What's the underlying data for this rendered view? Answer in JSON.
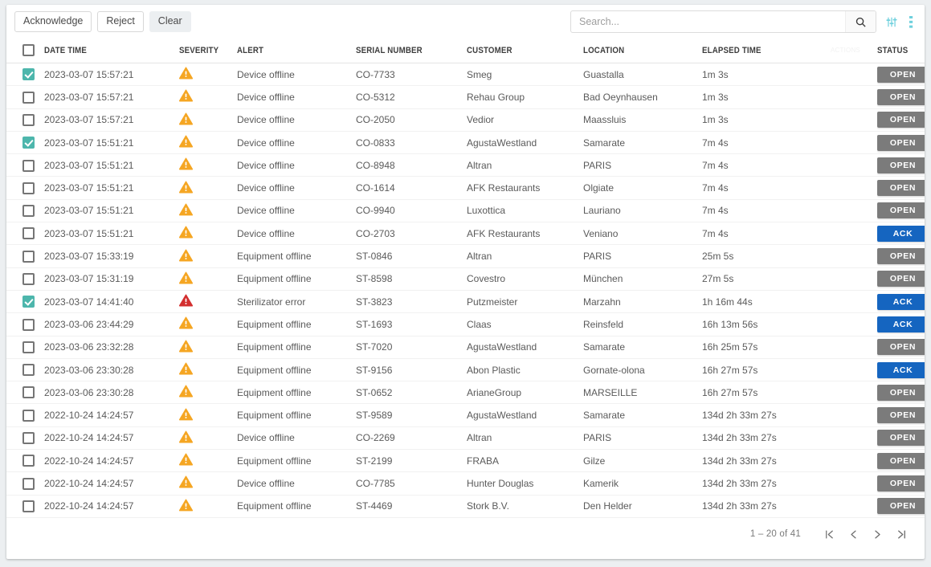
{
  "toolbar": {
    "acknowledge_label": "Acknowledge",
    "reject_label": "Reject",
    "clear_label": "Clear",
    "search_placeholder": "Search...",
    "search_value": "",
    "search_icon": "search-icon",
    "tune_icon": "sliders-filter-icon",
    "menu_icon": "more-vertical-icon",
    "accent_color": "#6fd0dd"
  },
  "table": {
    "headers": {
      "select_all": "",
      "date_time": "DATE TIME",
      "severity": "SEVERITY",
      "alert": "ALERT",
      "serial_number": "SERIAL NUMBER",
      "customer": "CUSTOMER",
      "location": "LOCATION",
      "elapsed_time": "ELAPSED TIME",
      "ghost": "ACTIONS",
      "status": "STATUS"
    },
    "colors": {
      "severity_warning": "#f5a623",
      "severity_critical": "#d32f2f",
      "status_open": "#7b7b7b",
      "status_ack": "#1565c0",
      "checkbox_checked": "#4db6ac"
    },
    "rows": [
      {
        "selected": true,
        "date_time": "2023-03-07 15:57:21",
        "severity": "warning",
        "alert": "Device offline",
        "serial_number": "CO-7733",
        "customer": "Smeg",
        "location": "Guastalla",
        "elapsed_time": "1m 3s",
        "status": "OPEN"
      },
      {
        "selected": false,
        "date_time": "2023-03-07 15:57:21",
        "severity": "warning",
        "alert": "Device offline",
        "serial_number": "CO-5312",
        "customer": "Rehau Group",
        "location": "Bad Oeynhausen",
        "elapsed_time": "1m 3s",
        "status": "OPEN"
      },
      {
        "selected": false,
        "date_time": "2023-03-07 15:57:21",
        "severity": "warning",
        "alert": "Device offline",
        "serial_number": "CO-2050",
        "customer": "Vedior",
        "location": "Maassluis",
        "elapsed_time": "1m 3s",
        "status": "OPEN"
      },
      {
        "selected": true,
        "date_time": "2023-03-07 15:51:21",
        "severity": "warning",
        "alert": "Device offline",
        "serial_number": "CO-0833",
        "customer": "AgustaWestland",
        "location": "Samarate",
        "elapsed_time": "7m 4s",
        "status": "OPEN"
      },
      {
        "selected": false,
        "date_time": "2023-03-07 15:51:21",
        "severity": "warning",
        "alert": "Device offline",
        "serial_number": "CO-8948",
        "customer": "Altran",
        "location": "PARIS",
        "elapsed_time": "7m 4s",
        "status": "OPEN"
      },
      {
        "selected": false,
        "date_time": "2023-03-07 15:51:21",
        "severity": "warning",
        "alert": "Device offline",
        "serial_number": "CO-1614",
        "customer": "AFK Restaurants",
        "location": "Olgiate",
        "elapsed_time": "7m 4s",
        "status": "OPEN"
      },
      {
        "selected": false,
        "date_time": "2023-03-07 15:51:21",
        "severity": "warning",
        "alert": "Device offline",
        "serial_number": "CO-9940",
        "customer": "Luxottica",
        "location": "Lauriano",
        "elapsed_time": "7m 4s",
        "status": "OPEN"
      },
      {
        "selected": false,
        "date_time": "2023-03-07 15:51:21",
        "severity": "warning",
        "alert": "Device offline",
        "serial_number": "CO-2703",
        "customer": "AFK Restaurants",
        "location": "Veniano",
        "elapsed_time": "7m 4s",
        "status": "ACK"
      },
      {
        "selected": false,
        "date_time": "2023-03-07 15:33:19",
        "severity": "warning",
        "alert": "Equipment offline",
        "serial_number": "ST-0846",
        "customer": "Altran",
        "location": "PARIS",
        "elapsed_time": "25m 5s",
        "status": "OPEN"
      },
      {
        "selected": false,
        "date_time": "2023-03-07 15:31:19",
        "severity": "warning",
        "alert": "Equipment offline",
        "serial_number": "ST-8598",
        "customer": "Covestro",
        "location": "München",
        "elapsed_time": "27m 5s",
        "status": "OPEN"
      },
      {
        "selected": true,
        "date_time": "2023-03-07 14:41:40",
        "severity": "critical",
        "alert": "Sterilizator error",
        "serial_number": "ST-3823",
        "customer": "Putzmeister",
        "location": "Marzahn",
        "elapsed_time": "1h 16m 44s",
        "status": "ACK"
      },
      {
        "selected": false,
        "date_time": "2023-03-06 23:44:29",
        "severity": "warning",
        "alert": "Equipment offline",
        "serial_number": "ST-1693",
        "customer": "Claas",
        "location": "Reinsfeld",
        "elapsed_time": "16h 13m 56s",
        "status": "ACK"
      },
      {
        "selected": false,
        "date_time": "2023-03-06 23:32:28",
        "severity": "warning",
        "alert": "Equipment offline",
        "serial_number": "ST-7020",
        "customer": "AgustaWestland",
        "location": "Samarate",
        "elapsed_time": "16h 25m 57s",
        "status": "OPEN"
      },
      {
        "selected": false,
        "date_time": "2023-03-06 23:30:28",
        "severity": "warning",
        "alert": "Equipment offline",
        "serial_number": "ST-9156",
        "customer": "Abon Plastic",
        "location": "Gornate-olona",
        "elapsed_time": "16h 27m 57s",
        "status": "ACK"
      },
      {
        "selected": false,
        "date_time": "2023-03-06 23:30:28",
        "severity": "warning",
        "alert": "Equipment offline",
        "serial_number": "ST-0652",
        "customer": "ArianeGroup",
        "location": "MARSEILLE",
        "elapsed_time": "16h 27m 57s",
        "status": "OPEN"
      },
      {
        "selected": false,
        "date_time": "2022-10-24 14:24:57",
        "severity": "warning",
        "alert": "Equipment offline",
        "serial_number": "ST-9589",
        "customer": "AgustaWestland",
        "location": "Samarate",
        "elapsed_time": "134d 2h 33m 27s",
        "status": "OPEN"
      },
      {
        "selected": false,
        "date_time": "2022-10-24 14:24:57",
        "severity": "warning",
        "alert": "Device offline",
        "serial_number": "CO-2269",
        "customer": "Altran",
        "location": "PARIS",
        "elapsed_time": "134d 2h 33m 27s",
        "status": "OPEN"
      },
      {
        "selected": false,
        "date_time": "2022-10-24 14:24:57",
        "severity": "warning",
        "alert": "Equipment offline",
        "serial_number": "ST-2199",
        "customer": "FRABA",
        "location": "Gilze",
        "elapsed_time": "134d 2h 33m 27s",
        "status": "OPEN"
      },
      {
        "selected": false,
        "date_time": "2022-10-24 14:24:57",
        "severity": "warning",
        "alert": "Device offline",
        "serial_number": "CO-7785",
        "customer": "Hunter Douglas",
        "location": "Kamerik",
        "elapsed_time": "134d 2h 33m 27s",
        "status": "OPEN"
      },
      {
        "selected": false,
        "date_time": "2022-10-24 14:24:57",
        "severity": "warning",
        "alert": "Equipment offline",
        "serial_number": "ST-4469",
        "customer": "Stork B.V.",
        "location": "Den Helder",
        "elapsed_time": "134d 2h 33m 27s",
        "status": "OPEN"
      }
    ]
  },
  "paginator": {
    "range_label": "1 – 20 of 41",
    "first_icon": "first-page-icon",
    "prev_icon": "previous-page-icon",
    "next_icon": "next-page-icon",
    "last_icon": "last-page-icon"
  }
}
